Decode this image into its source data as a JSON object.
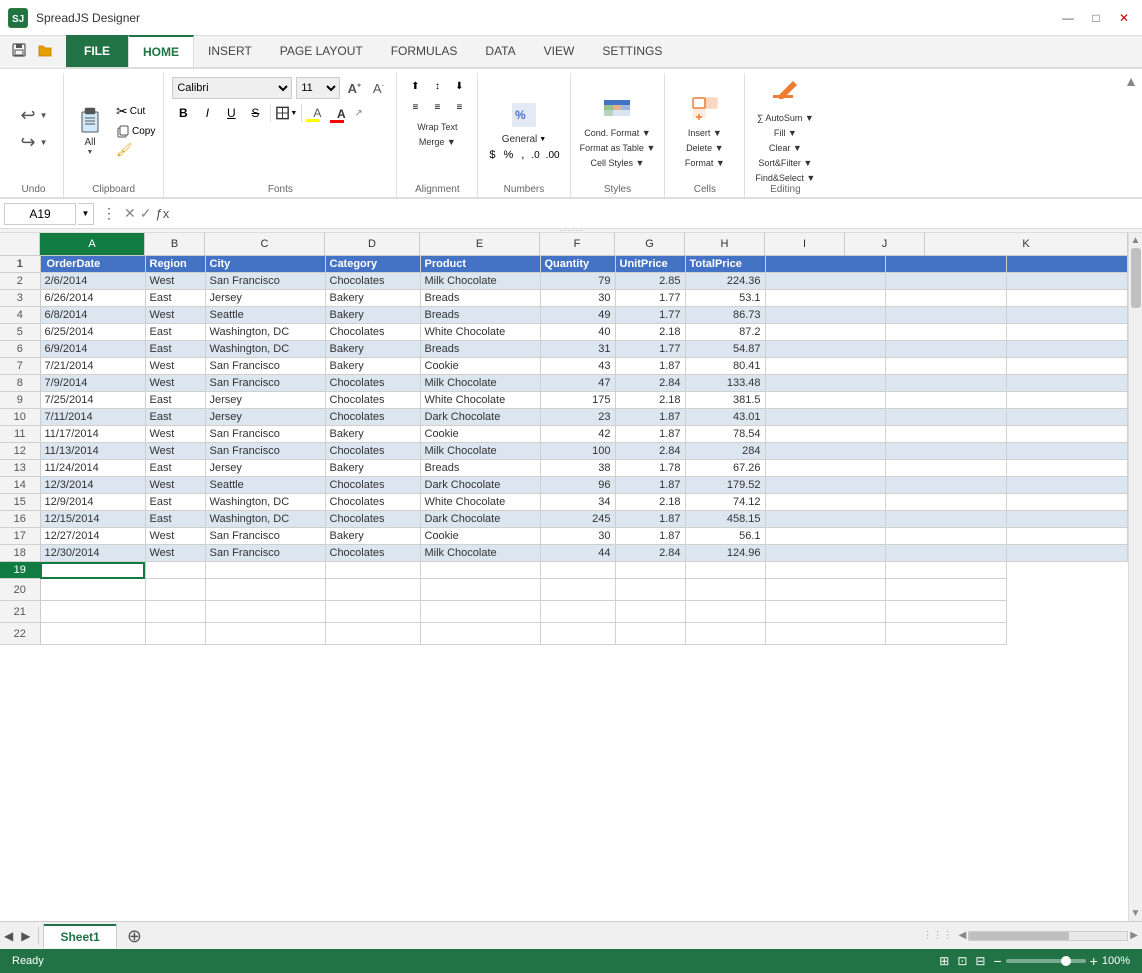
{
  "app": {
    "title": "SpreadJS Designer",
    "logo": "SJ"
  },
  "titlebar": {
    "controls": [
      "—",
      "□",
      "✕"
    ]
  },
  "quickaccess": {
    "buttons": [
      "💾",
      "📁"
    ]
  },
  "ribbon": {
    "tabs": [
      "FILE",
      "HOME",
      "INSERT",
      "PAGE LAYOUT",
      "FORMULAS",
      "DATA",
      "VIEW",
      "SETTINGS"
    ],
    "active_tab": "HOME",
    "groups": {
      "undo": {
        "label": "Undo",
        "undo_label": "↩",
        "redo_label": "↪"
      },
      "clipboard": {
        "label": "Clipboard",
        "paste_label": "All",
        "buttons": [
          "Cut",
          "Copy",
          "Format Painter"
        ]
      },
      "fonts": {
        "label": "Fonts",
        "font_family": "Calibri",
        "font_size": "11",
        "grow_label": "A↑",
        "shrink_label": "A↓",
        "bold": "B",
        "italic": "I",
        "underline": "U",
        "strikethrough": "S"
      },
      "alignment": {
        "label": "Alignment"
      },
      "numbers": {
        "label": "Numbers"
      },
      "styles": {
        "label": "Styles"
      },
      "cells": {
        "label": "Cells"
      },
      "editing": {
        "label": "Editing"
      }
    }
  },
  "formulabar": {
    "cell_ref": "A19",
    "formula_text": ""
  },
  "grid": {
    "columns": [
      "A",
      "B",
      "C",
      "D",
      "E",
      "F",
      "G",
      "H",
      "I",
      "J",
      "K"
    ],
    "headers": [
      "OrderDate",
      "Region",
      "City",
      "Category",
      "Product",
      "Quantity",
      "UnitPrice",
      "TotalPrice"
    ],
    "rows": [
      [
        "2/6/2014",
        "West",
        "San Francisco",
        "Chocolates",
        "Milk Chocolate",
        "79",
        "2.85",
        "224.36"
      ],
      [
        "6/26/2014",
        "East",
        "Jersey",
        "Bakery",
        "Breads",
        "30",
        "1.77",
        "53.1"
      ],
      [
        "6/8/2014",
        "West",
        "Seattle",
        "Bakery",
        "Breads",
        "49",
        "1.77",
        "86.73"
      ],
      [
        "6/25/2014",
        "East",
        "Washington, DC",
        "Chocolates",
        "White Chocolate",
        "40",
        "2.18",
        "87.2"
      ],
      [
        "6/9/2014",
        "East",
        "Washington, DC",
        "Bakery",
        "Breads",
        "31",
        "1.77",
        "54.87"
      ],
      [
        "7/21/2014",
        "West",
        "San Francisco",
        "Bakery",
        "Cookie",
        "43",
        "1.87",
        "80.41"
      ],
      [
        "7/9/2014",
        "West",
        "San Francisco",
        "Chocolates",
        "Milk Chocolate",
        "47",
        "2.84",
        "133.48"
      ],
      [
        "7/25/2014",
        "East",
        "Jersey",
        "Chocolates",
        "White Chocolate",
        "175",
        "2.18",
        "381.5"
      ],
      [
        "7/11/2014",
        "East",
        "Jersey",
        "Chocolates",
        "Dark Chocolate",
        "23",
        "1.87",
        "43.01"
      ],
      [
        "11/17/2014",
        "West",
        "San Francisco",
        "Bakery",
        "Cookie",
        "42",
        "1.87",
        "78.54"
      ],
      [
        "11/13/2014",
        "West",
        "San Francisco",
        "Chocolates",
        "Milk Chocolate",
        "100",
        "2.84",
        "284"
      ],
      [
        "11/24/2014",
        "East",
        "Jersey",
        "Bakery",
        "Breads",
        "38",
        "1.78",
        "67.26"
      ],
      [
        "12/3/2014",
        "West",
        "Seattle",
        "Chocolates",
        "Dark Chocolate",
        "96",
        "1.87",
        "179.52"
      ],
      [
        "12/9/2014",
        "East",
        "Washington, DC",
        "Chocolates",
        "White Chocolate",
        "34",
        "2.18",
        "74.12"
      ],
      [
        "12/15/2014",
        "East",
        "Washington, DC",
        "Chocolates",
        "Dark Chocolate",
        "245",
        "1.87",
        "458.15"
      ],
      [
        "12/27/2014",
        "West",
        "San Francisco",
        "Bakery",
        "Cookie",
        "30",
        "1.87",
        "56.1"
      ],
      [
        "12/30/2014",
        "West",
        "San Francisco",
        "Chocolates",
        "Milk Chocolate",
        "44",
        "2.84",
        "124.96"
      ]
    ],
    "active_cell": "A19",
    "active_row": 19,
    "empty_rows": [
      19,
      20,
      21,
      22
    ]
  },
  "sheets": {
    "tabs": [
      "Sheet1"
    ],
    "active": "Sheet1"
  },
  "statusbar": {
    "status": "Ready",
    "zoom": "100%"
  }
}
